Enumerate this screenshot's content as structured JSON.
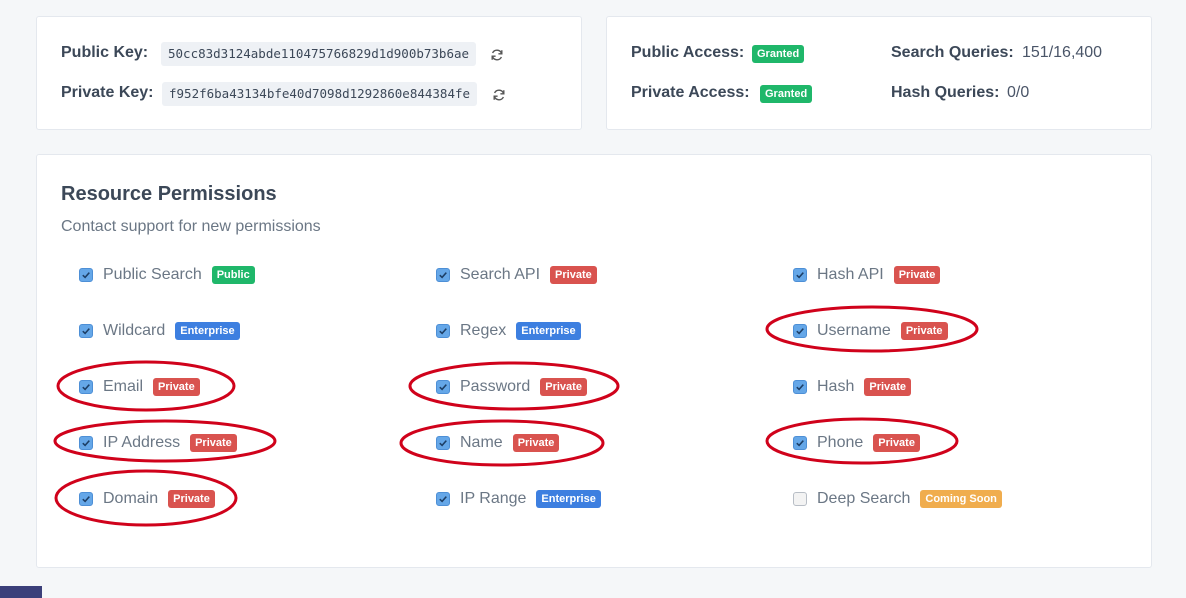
{
  "keys": {
    "public_label": "Public Key:",
    "public_value": "50cc83d3124abde110475766829d1d900b73b6ae",
    "private_label": "Private Key:",
    "private_value": "f952f6ba43134bfe40d7098d1292860e844384fe",
    "refresh_icon": "refresh-icon"
  },
  "access": {
    "public_label": "Public Access:",
    "public_status": "Granted",
    "private_label": "Private Access:",
    "private_status": "Granted",
    "search_label": "Search Queries:",
    "search_value": "151/16,400",
    "hash_label": "Hash Queries:",
    "hash_value": "0/0"
  },
  "permissions": {
    "title": "Resource Permissions",
    "subtitle": "Contact support for new permissions",
    "items": [
      {
        "label": "Public Search",
        "badge": "Public",
        "checked": true
      },
      {
        "label": "Search API",
        "badge": "Private",
        "checked": true
      },
      {
        "label": "Hash API",
        "badge": "Private",
        "checked": true
      },
      {
        "label": "Wildcard",
        "badge": "Enterprise",
        "checked": true
      },
      {
        "label": "Regex",
        "badge": "Enterprise",
        "checked": true
      },
      {
        "label": "Username",
        "badge": "Private",
        "checked": true
      },
      {
        "label": "Email",
        "badge": "Private",
        "checked": true
      },
      {
        "label": "Password",
        "badge": "Private",
        "checked": true
      },
      {
        "label": "Hash",
        "badge": "Private",
        "checked": true
      },
      {
        "label": "IP Address",
        "badge": "Private",
        "checked": true
      },
      {
        "label": "Name",
        "badge": "Private",
        "checked": true
      },
      {
        "label": "Phone",
        "badge": "Private",
        "checked": true
      },
      {
        "label": "Domain",
        "badge": "Private",
        "checked": true
      },
      {
        "label": "IP Range",
        "badge": "Enterprise",
        "checked": true
      },
      {
        "label": "Deep Search",
        "badge": "Coming Soon",
        "checked": false
      }
    ]
  },
  "colors": {
    "granted": "#1fb76a",
    "public": "#1fb76a",
    "private": "#d9534f",
    "enterprise": "#3d7fe0",
    "coming_soon": "#f0ad4e",
    "annotation": "#d0021b"
  }
}
